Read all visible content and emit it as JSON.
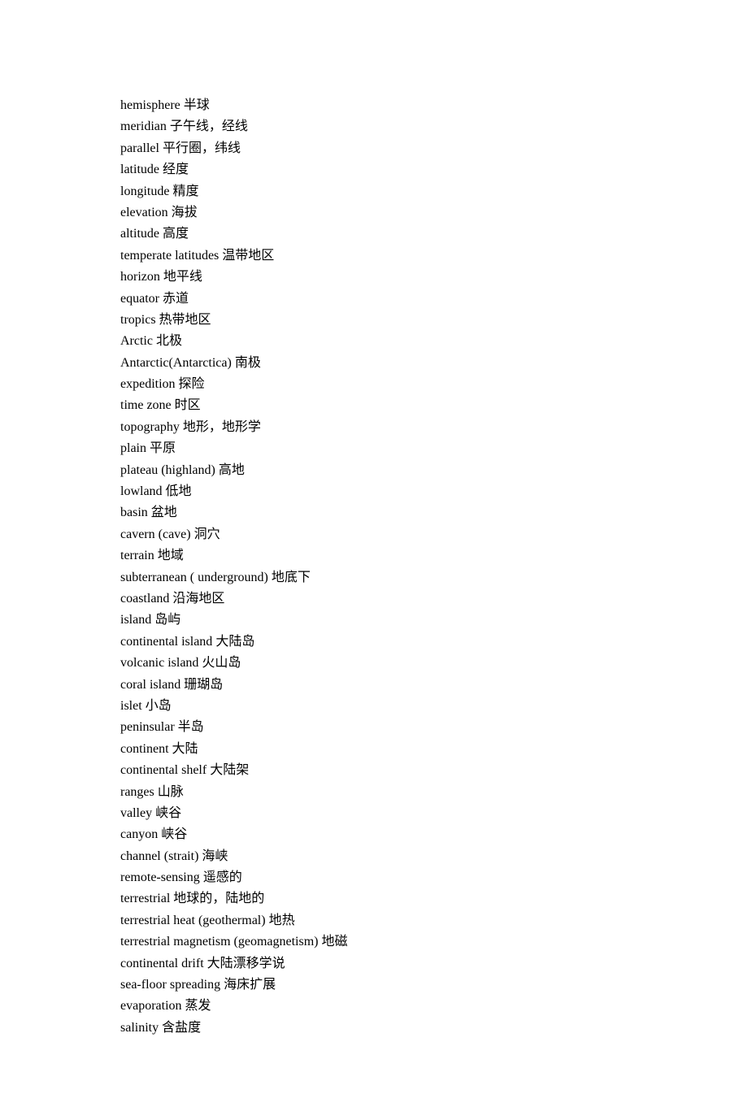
{
  "entries": [
    {
      "en": "hemisphere",
      "zh": "半球"
    },
    {
      "en": "meridian",
      "zh": "子午线，经线"
    },
    {
      "en": "parallel",
      "zh": "平行圈，纬线"
    },
    {
      "en": "latitude",
      "zh": "经度"
    },
    {
      "en": "longitude",
      "zh": "精度"
    },
    {
      "en": "elevation",
      "zh": "海拔"
    },
    {
      "en": "altitude",
      "zh": "高度"
    },
    {
      "en": "temperate latitudes",
      "zh": "温带地区"
    },
    {
      "en": "horizon",
      "zh": "地平线"
    },
    {
      "en": "equator",
      "zh": "赤道"
    },
    {
      "en": "tropics",
      "zh": "热带地区"
    },
    {
      "en": "Arctic",
      "zh": "北极"
    },
    {
      "en": "Antarctic(Antarctica)",
      "zh": "南极"
    },
    {
      "en": "expedition",
      "zh": "探险"
    },
    {
      "en": "time zone",
      "zh": "时区"
    },
    {
      "en": "topography",
      "zh": "地形，地形学"
    },
    {
      "en": "plain",
      "zh": "平原"
    },
    {
      "en": "plateau (highland)",
      "zh": "高地"
    },
    {
      "en": "lowland",
      "zh": "低地"
    },
    {
      "en": "basin",
      "zh": "盆地"
    },
    {
      "en": "cavern (cave)",
      "zh": "洞穴"
    },
    {
      "en": "terrain",
      "zh": "地域"
    },
    {
      "en": "subterranean ( underground)",
      "zh": "地底下"
    },
    {
      "en": "coastland",
      "zh": "沿海地区"
    },
    {
      "en": "island",
      "zh": "岛屿"
    },
    {
      "en": "continental island",
      "zh": "大陆岛"
    },
    {
      "en": "volcanic island",
      "zh": "火山岛"
    },
    {
      "en": "coral island",
      "zh": "珊瑚岛"
    },
    {
      "en": "islet",
      "zh": "小岛"
    },
    {
      "en": "peninsular",
      "zh": "半岛"
    },
    {
      "en": "continent",
      "zh": "大陆"
    },
    {
      "en": "continental shelf",
      "zh": "大陆架"
    },
    {
      "en": "ranges",
      "zh": "山脉"
    },
    {
      "en": "valley",
      "zh": "峡谷"
    },
    {
      "en": "canyon",
      "zh": "峡谷"
    },
    {
      "en": "channel (strait)",
      "zh": "海峡"
    },
    {
      "en": "remote-sensing",
      "zh": "遥感的"
    },
    {
      "en": "terrestrial",
      "zh": "地球的，陆地的"
    },
    {
      "en": "terrestrial heat (geothermal)",
      "zh": "地热"
    },
    {
      "en": "terrestrial magnetism (geomagnetism)",
      "zh": "地磁"
    },
    {
      "en": "continental drift",
      "zh": "大陆漂移学说"
    },
    {
      "en": "sea-floor spreading",
      "zh": "海床扩展"
    },
    {
      "en": "evaporation",
      "zh": "蒸发"
    },
    {
      "en": "salinity",
      "zh": "含盐度"
    }
  ]
}
